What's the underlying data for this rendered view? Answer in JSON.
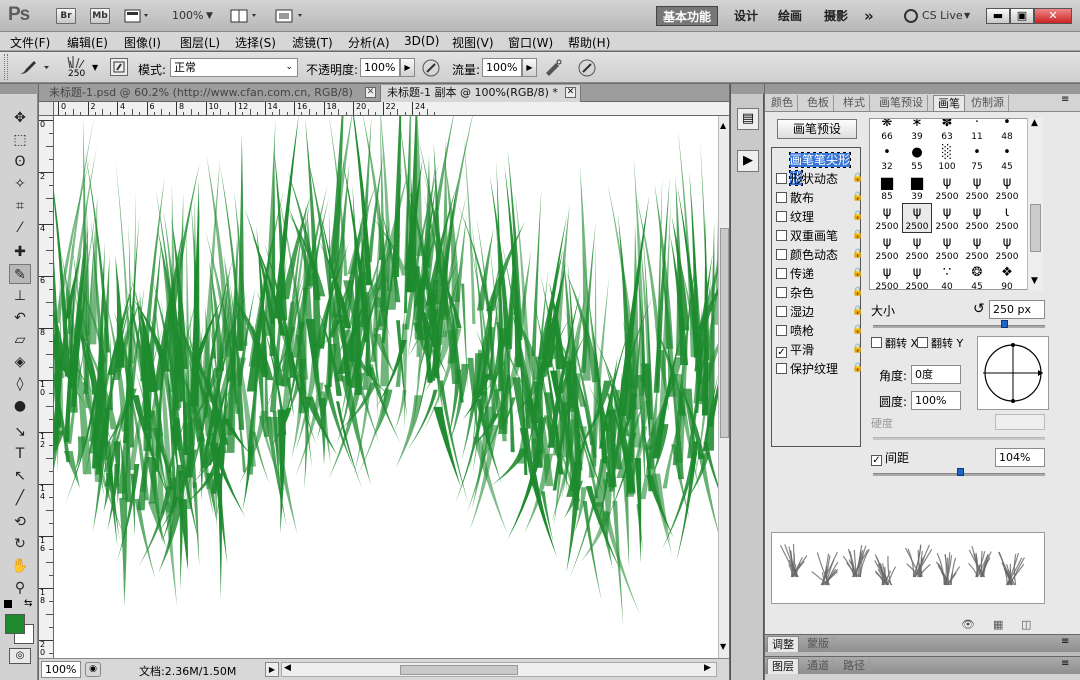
{
  "titlebar": {
    "app_icon": "Ps",
    "br": "Br",
    "mb": "Mb",
    "zoom": "100%",
    "workspaces": [
      "基本功能",
      "设计",
      "绘画",
      "摄影"
    ],
    "more": "»",
    "cslive": "CS Live"
  },
  "menu": [
    "文件(F)",
    "编辑(E)",
    "图像(I)",
    "图层(L)",
    "选择(S)",
    "滤镜(T)",
    "分析(A)",
    "3D(D)",
    "视图(V)",
    "窗口(W)",
    "帮助(H)"
  ],
  "options": {
    "brush_size": "250",
    "mode_label": "模式:",
    "mode_value": "正常",
    "opacity_label": "不透明度:",
    "opacity_value": "100%",
    "flow_label": "流量:",
    "flow_value": "100%"
  },
  "tabs": [
    {
      "label": "未标题-1.psd @ 60.2% (http://www.cfan.com.cn, RGB/8)",
      "active": false
    },
    {
      "label": "未标题-1 副本 @ 100%(RGB/8) *",
      "active": true
    }
  ],
  "ruler_h": [
    "0",
    "2",
    "4",
    "6",
    "8",
    "10",
    "12",
    "14",
    "16",
    "18",
    "20",
    "22",
    "24"
  ],
  "ruler_v": [
    "0",
    "2",
    "4",
    "6",
    "8",
    "1\n0",
    "1\n2",
    "1\n4",
    "1\n6",
    "1\n8",
    "2\n0"
  ],
  "status": {
    "zoom": "100%",
    "doc": "文档:2.36M/1.50M"
  },
  "panel": {
    "tabs": [
      "颜色",
      "色板",
      "样式",
      "画笔预设",
      "画笔",
      "仿制源"
    ],
    "preset_button": "画笔预设",
    "options": [
      {
        "label": "画笔笔尖形状",
        "checked": null,
        "selected": true,
        "lock": false
      },
      {
        "label": "形状动态",
        "checked": false,
        "lock": true
      },
      {
        "label": "散布",
        "checked": false,
        "lock": true
      },
      {
        "label": "纹理",
        "checked": false,
        "lock": true
      },
      {
        "label": "双重画笔",
        "checked": false,
        "lock": true
      },
      {
        "label": "颜色动态",
        "checked": false,
        "lock": true
      },
      {
        "label": "传递",
        "checked": false,
        "lock": true
      },
      {
        "label": "杂色",
        "checked": false,
        "lock": true
      },
      {
        "label": "湿边",
        "checked": false,
        "lock": true
      },
      {
        "label": "喷枪",
        "checked": false,
        "lock": true
      },
      {
        "label": "平滑",
        "checked": true,
        "lock": true
      },
      {
        "label": "保护纹理",
        "checked": false,
        "lock": true
      }
    ],
    "brush_sizes": [
      "66",
      "39",
      "63",
      "11",
      "48",
      "32",
      "55",
      "100",
      "75",
      "45",
      "85",
      "39",
      "2500",
      "2500",
      "2500",
      "2500",
      "2500",
      "2500",
      "2500",
      "2500",
      "2500",
      "2500",
      "2500",
      "2500",
      "2500",
      "2500",
      "2500",
      "40",
      "45",
      "90"
    ],
    "size_label": "大小",
    "size_value": "250 px",
    "flipx": "翻转 X",
    "flipy": "翻转 Y",
    "angle_label": "角度:",
    "angle_value": "0度",
    "round_label": "圆度:",
    "round_value": "100%",
    "hardness_label": "硬度",
    "spacing_label": "间距",
    "spacing_value": "104%",
    "spacing_checked": true,
    "bottom_tabs_1": [
      "调整",
      "蒙版"
    ],
    "bottom_tabs_2": [
      "图层",
      "通道",
      "路径"
    ]
  },
  "colors": {
    "foreground": "#1e8a2e",
    "background": "#ffffff",
    "grass": "#1e8a2e",
    "accent": "#1f65c6"
  }
}
